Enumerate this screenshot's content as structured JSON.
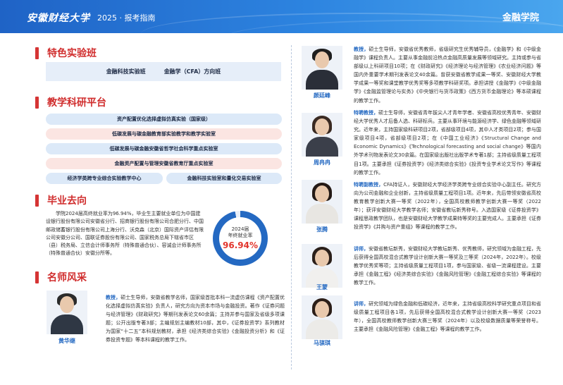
{
  "header": {
    "logo": "安徽财经大学",
    "subtitle": "2025 · 报考指南",
    "section": "金融学院"
  },
  "labs": {
    "title": "特色实验班",
    "items": [
      "金融科技实验班",
      "金融学（CFA）方向班"
    ]
  },
  "platforms": {
    "title": "教学科研平台",
    "items": [
      "资产配置优化选择虚拟仿真实验（国家级）",
      "低碳发展与碳金融教育部实验教学和教学实验室",
      "低碳发展与碳金融安徽省哲学社会科学重点实验室",
      "金融资产配置与管理安徽省教育厅重点实验室",
      "经济学类跨专业综合实验教学中心",
      "金融科技实验室和量化交易实验室"
    ]
  },
  "employment": {
    "title": "毕业去向",
    "text": "学院2024届高终就业率为96.94%，毕业生主要就业单位为中国建设银行股份有限公司安徽省分行、招商银行股份有限公司合肥分行、中国邮政储蓄银行股份有限公司上海分行、沃克森（北京）国际资产评估有限公司安徽分公司、国联证券股份有限公司、国家税务总局下辖省市区（县）税务局、立信会计师事务所（特殊普通合伙）、容诚会计师事务所（特殊普通合伙）安徽分所等。",
    "ring_label1": "2024届",
    "ring_label2": "年终就业率",
    "rate_text": "96.94%",
    "rate": 96.94
  },
  "faculty": {
    "title": "名师风采",
    "teachers": [
      {
        "name": "黄华继",
        "role": "教授，",
        "bio": "硕士生导师，安徽省教学名师，国家级首批本科一流虚仿课程《资产配置优化选择虚拟仿真实验》负责人，研究方向为资本市场与金融投资。著作《证券问题与经济管理》《财政研究》等期刊发表论文60余篇；主持并参与国家及省级多项课题；公开出版专著3部；主编规划主编教材10部，其中，《证券投资学》系列教材为国家“十二五”本科规划教材，承担《经济类综合实验》《金融投资分析》和《证券投资专题》等本科课程的教学工作。"
      },
      {
        "name": "颜廷峰",
        "role": "教授，",
        "bio": "硕士生导师，安徽省优秀教师，省级研究生优秀辅导员，《金融学》和《中级金融学》课程负责人。主要从事金融前沿热点金融高质量发展等领域研究。主持或参与省部级以上科研项目10项；在《财政研究》《经济理论与经济管理》《农业经济问题》等国内外重要学术期刊发表论文40余篇。曾获安徽省教学成果一等奖、安徽财经大学教学成果一等奖和课堂教学优秀奖等多项教学科研奖项。承担讲授《金融学》《中级金融学》《金融监管理论与实务》《中央银行与货币政策》《西方货币金融理论》等本硕课程的教学工作。"
      },
      {
        "name": "周冉冉",
        "role": "特聘教授，",
        "bio": "硕士生导师，安徽省青年拔尖人才青年学者、安徽省高校优秀青年、安徽财经大学优秀人才后备人选、科研标兵。主要从事环境与能源经济学、绿色金融等领域研究。近年来，主持国家级科研项目2项，省部级项目4项，其中人才类项目2项；参与国家级项目4项，省部级项目2项；在《中国工业经济》《Structural Change and Economic Dynamics》《Technological forecasting and social change》等国内外学术刊物发表论文30余篇。在国家级出版社出版学术专著1部；主持省级质量工程项目1项。主要承担《证券投资学》《经济类综合实验》《投资专业学术论文写作》等课程的教学工作。"
      },
      {
        "name": "张腾",
        "role": "特聘副教授，",
        "bio": "CFA持证人，安徽财经大学经济学类跨专业综合实验中心副主任。研究方向为公司金融和企业创新，主持省级质量工程项目1项。近年来，先后带领安徽省高校教育教学创新大赛一等奖（2022年），全国高校教师教学创新大赛一等奖（2022年）；获评安徽财经大学教学名师；安徽省教坛新秀称号。入选国家级《证券投资学》课程思政教学团队，也是安徽财经大学教学成果特等奖的主要完成人。主要承担《证券投资学》《并购与资产重组》等课程的教学工作。"
      },
      {
        "name": "王蒙",
        "role": "讲师，",
        "bio": "安徽省教坛新秀，安徽财经大学教坛新秀、优秀教师，研究领域为金融工程，先后获得全国高校混合式教学设计创新大赛一等奖及三等奖（2024年，2022年）。校级教学优秀奖等项；主持省级质量工程项目1项，参与国家级、省级一流课程建设。主要承担《金融工程》《经济类综合实验》《金融风险管理》《金融工程综合实验》等课程的教学工作。"
      },
      {
        "name": "马骐琪",
        "role": "讲师，",
        "bio": "研究领域为绿色金融和低碳经济，近年来，主持省级高校科学研究重点项目和省级质量工程项目各1项，先后获得全国高校混合式教学设计创新大赛一等奖（2023年），全国高校教师教学创新大赛三等奖（2024年）以及校级数据质量等荣誉称号。主要承担《金融风险管理》《金融工程》等课程的教学工作。"
      }
    ]
  },
  "colors": {
    "accent_red": "#d02d2d",
    "brand_blue": "#2469c2",
    "pill_blue": "#dce9f8",
    "pill_pink": "#fbe5e2"
  }
}
